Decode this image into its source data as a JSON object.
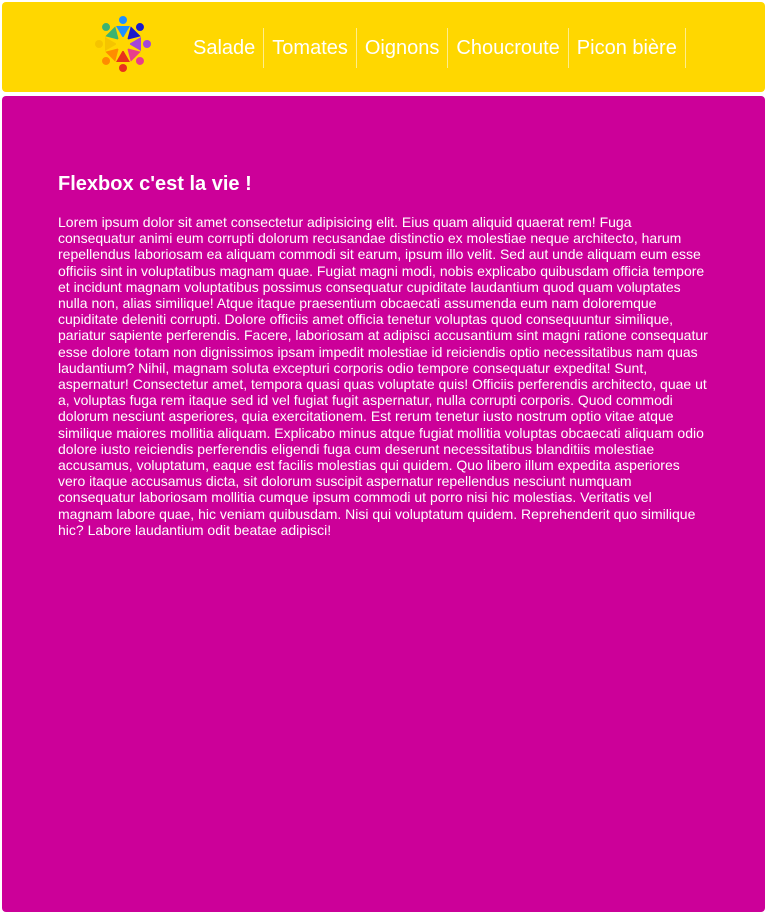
{
  "header": {
    "background": "#ffd700",
    "logo": {
      "icon": "colorful-people-circle-logo-icon"
    },
    "nav": {
      "items": [
        {
          "label": "Salade"
        },
        {
          "label": "Tomates"
        },
        {
          "label": "Oignons"
        },
        {
          "label": "Choucroute"
        },
        {
          "label": "Picon bière"
        }
      ]
    }
  },
  "main": {
    "background": "#cc0099",
    "title": "Flexbox c'est la vie !",
    "body": "Lorem ipsum dolor sit amet consectetur adipisicing elit. Eius quam aliquid quaerat rem! Fuga consequatur animi eum corrupti dolorum recusandae distinctio ex molestiae neque architecto, harum repellendus laboriosam ea aliquam commodi sit earum, ipsum illo velit. Sed aut unde aliquam eum esse officiis sint in voluptatibus magnam quae. Fugiat magni modi, nobis explicabo quibusdam officia tempore et incidunt magnam voluptatibus possimus consequatur cupiditate laudantium quod quam voluptates nulla non, alias similique! Atque itaque praesentium obcaecati assumenda eum nam doloremque cupiditate deleniti corrupti. Dolore officiis amet officia tenetur voluptas quod consequuntur similique, pariatur sapiente perferendis. Facere, laboriosam at adipisci accusantium sint magni ratione consequatur esse dolore totam non dignissimos ipsam impedit molestiae id reiciendis optio necessitatibus nam quas laudantium? Nihil, magnam soluta excepturi corporis odio tempore consequatur expedita! Sunt, aspernatur! Consectetur amet, tempora quasi quas voluptate quis! Officiis perferendis architecto, quae ut a, voluptas fuga rem itaque sed id vel fugiat fugit aspernatur, nulla corrupti corporis. Quod commodi dolorum nesciunt asperiores, quia exercitationem. Est rerum tenetur iusto nostrum optio vitae atque similique maiores mollitia aliquam. Explicabo minus atque fugiat mollitia voluptas obcaecati aliquam odio dolore iusto reiciendis perferendis eligendi fuga cum deserunt necessitatibus blanditiis molestiae accusamus, voluptatum, eaque est facilis molestias qui quidem. Quo libero illum expedita asperiores vero itaque accusamus dicta, sit dolorum suscipit aspernatur repellendus nesciunt numquam consequatur laboriosam mollitia cumque ipsum commodi ut porro nisi hic molestias. Veritatis vel magnam labore quae, hic veniam quibusdam. Nisi qui voluptatum quidem. Reprehenderit quo similique hic? Labore laudantium odit beatae adipisci!"
  }
}
